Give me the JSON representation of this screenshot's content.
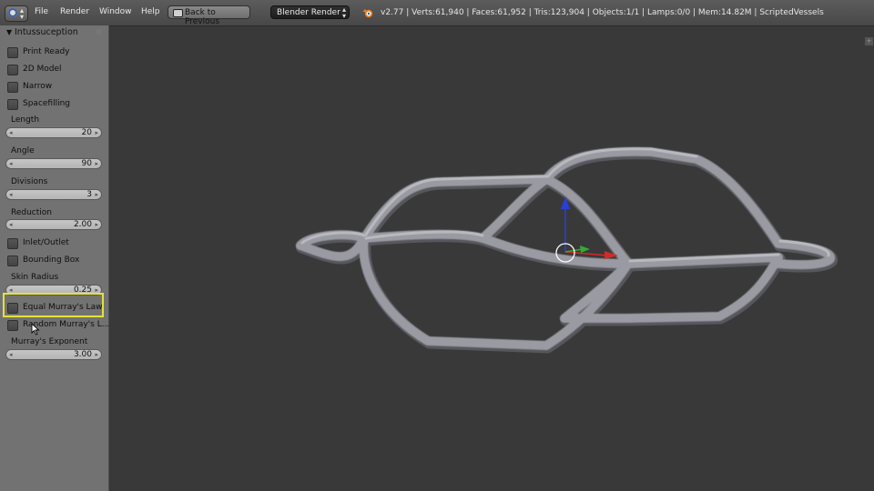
{
  "topbar": {
    "menus": [
      "File",
      "Render",
      "Window",
      "Help"
    ],
    "back_button": "Back to Previous",
    "render_engine": "Blender Render",
    "stats": "v2.77 | Verts:61,940 | Faces:61,952 | Tris:123,904 | Objects:1/1 | Lamps:0/0 | Mem:14.82M | ScriptedVessels"
  },
  "panel": {
    "title": "Intussuception",
    "checkboxes_top": [
      "Print Ready",
      "2D Model",
      "Narrow",
      "Spacefilling"
    ],
    "length": {
      "label": "Length",
      "value": "20"
    },
    "angle": {
      "label": "Angle",
      "value": "90"
    },
    "divisions": {
      "label": "Divisions",
      "value": "3"
    },
    "reduction": {
      "label": "Reduction",
      "value": "2.00"
    },
    "inlet_outlet": "Inlet/Outlet",
    "bounding_box": "Bounding Box",
    "skin_radius": {
      "label": "Skin Radius",
      "value": "0.25"
    },
    "equal_murray": "Equal Murray's Law",
    "random_murray": "Random Murray's L...",
    "murray_exponent": {
      "label": "Murray's Exponent",
      "value": "3.00"
    }
  },
  "colors": {
    "viewport_bg": "#393939",
    "shelf_bg": "#727272",
    "highlight": "#e3e33a",
    "mesh": "#9a9aa2",
    "axis_x": "#d22a2a",
    "axis_y": "#2fae2f",
    "axis_z": "#2a3fd6"
  },
  "icons": {
    "editor_type": "info-editor-icon",
    "back": "screen-icon",
    "blender_logo": "blender-logo-icon",
    "cursor": "mouse-pointer-icon"
  }
}
